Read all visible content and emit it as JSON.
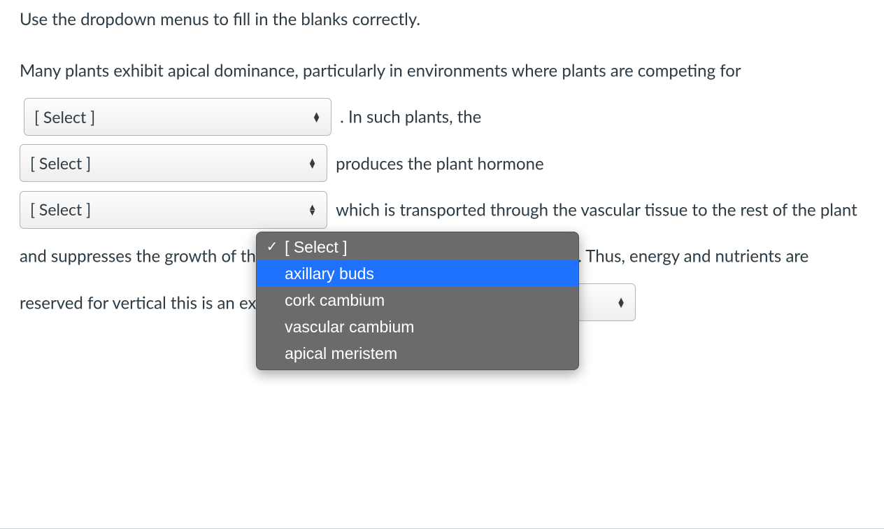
{
  "instruction": "Use the dropdown menus to fill in the blanks correctly.",
  "select_placeholder": "[ Select ]",
  "paragraph": {
    "p1a": "Many plants exhibit apical dominance, particularly in environments where plants are competing for ",
    "p1b": " .  In such plants, the ",
    "p2a": " produces the plant hormone ",
    "p3a": " which is transported through the vascular tissue to the rest of the plant and suppresses the growth of th",
    "p4a": " . Thus, energy and nutrients are reserved for vertical",
    "p4b": " this is an example of "
  },
  "peek_letter": "e",
  "dropdown_open": {
    "options": [
      "[ Select ]",
      "axillary buds",
      "cork cambium",
      "vascular cambium",
      "apical meristem"
    ],
    "selected_index": 0,
    "highlighted_index": 1
  }
}
